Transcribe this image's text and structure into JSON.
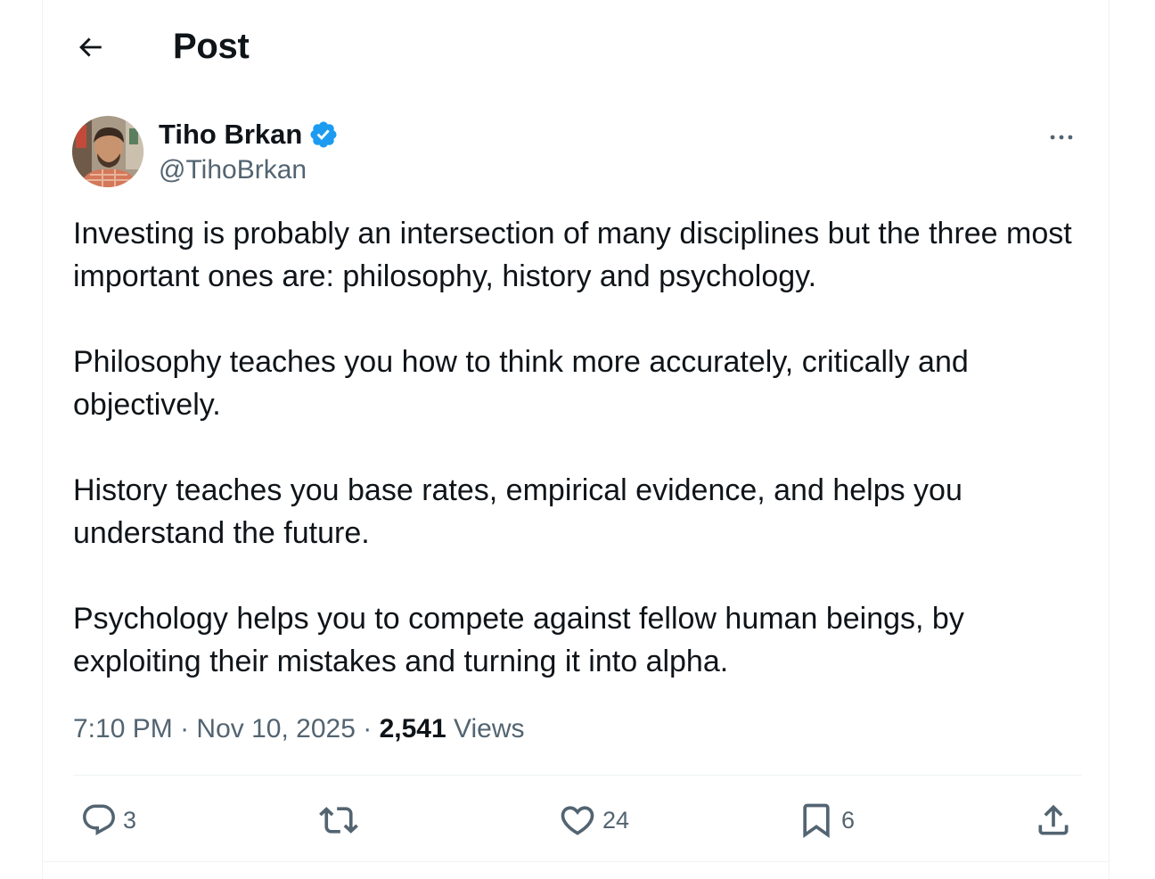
{
  "header": {
    "title": "Post",
    "back_icon": "arrow-left-icon"
  },
  "author": {
    "display_name": "Tiho Brkan",
    "handle": "@TihoBrkan",
    "verified": true,
    "verified_color": "#1d9bf0"
  },
  "tweet": {
    "paragraphs": [
      "Investing is probably an intersection of many disciplines but the three most important ones are: philosophy, history and psychology.",
      "Philosophy teaches you how to think more accurately, critically and objectively.",
      "History teaches you base rates, empirical evidence, and helps you understand the future.",
      "Psychology helps you to compete against fellow human beings, by exploiting their mistakes and turning it into alpha."
    ]
  },
  "meta": {
    "time": "7:10 PM",
    "separator": "·",
    "date": "Nov 10, 2025",
    "views_count": "2,541",
    "views_label": "Views"
  },
  "actions": {
    "replies": "3",
    "reposts": "",
    "likes": "24",
    "bookmarks": "6"
  },
  "colors": {
    "text_primary": "#0f1419",
    "text_secondary": "#536471",
    "divider": "#eff3f4",
    "accent": "#1d9bf0"
  }
}
